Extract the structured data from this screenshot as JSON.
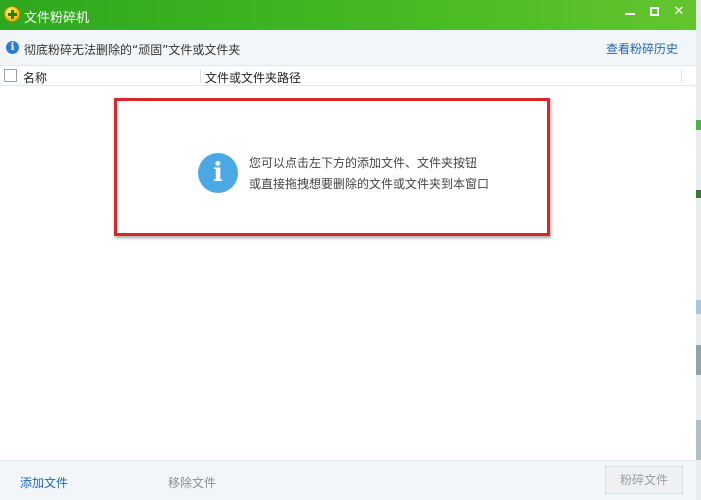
{
  "window": {
    "title": "文件粉碎机"
  },
  "info_bar": {
    "text": "彻底粉碎无法删除的“顽固”文件或文件夹",
    "history_link": "查看粉碎历史"
  },
  "list": {
    "columns": [
      "名称",
      "文件或文件夹路径"
    ]
  },
  "empty_state": {
    "icon": "info-icon",
    "line1": "您可以点击左下方的添加文件、文件夹按钮",
    "line2": "或直接拖拽想要删除的文件或文件夹到本窗口"
  },
  "footer": {
    "add_file": "添加文件",
    "remove_file": "移除文件",
    "shred_file": "粉碎文件"
  },
  "colors": {
    "titlebar": "#45b821",
    "link": "#1f66b8",
    "highlight_border": "#d9262b",
    "info_icon": "#4aa9e5"
  }
}
